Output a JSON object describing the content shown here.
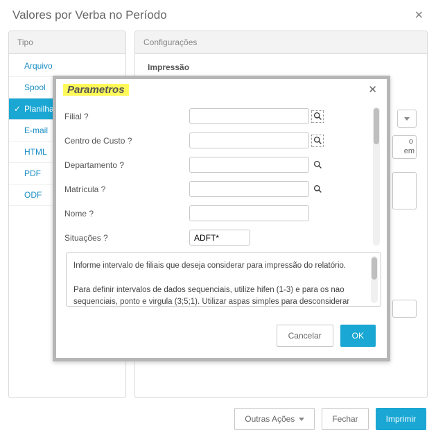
{
  "header": {
    "title": "Valores por Verba no Período"
  },
  "sidebar": {
    "title": "Tipo",
    "items": [
      {
        "label": "Arquivo"
      },
      {
        "label": "Spool"
      },
      {
        "label": "Planilha"
      },
      {
        "label": "E-mail"
      },
      {
        "label": "HTML"
      },
      {
        "label": "PDF"
      },
      {
        "label": "ODF"
      }
    ],
    "selected_index": 2
  },
  "content": {
    "title": "Configurações",
    "section_label": "Impressão",
    "bg_text_1": "o",
    "bg_text_2": "em"
  },
  "footer": {
    "other_actions": "Outras Ações",
    "close": "Fechar",
    "print": "Imprimir"
  },
  "modal": {
    "title": "Parametros",
    "fields": {
      "filial": {
        "label": "Filial ?",
        "value": ""
      },
      "centro": {
        "label": "Centro de Custo ?",
        "value": ""
      },
      "departamento": {
        "label": "Departamento ?",
        "value": ""
      },
      "matricula": {
        "label": "Matrícula ?",
        "value": ""
      },
      "nome": {
        "label": "Nome ?",
        "value": ""
      },
      "situacoes": {
        "label": "Situações ?",
        "value": "ADFT*"
      }
    },
    "help": {
      "line1": "Informe intervalo de filiais que deseja considerar para impressão do relatório.",
      "line2": "Para definir intervalos de dados sequenciais, utilize hifen (1-3) e para os nao sequenciais, ponto e virgula (3;5;1). Utilizar aspas simples para desconsiderar hifens"
    },
    "buttons": {
      "cancel": "Cancelar",
      "ok": "OK"
    }
  }
}
